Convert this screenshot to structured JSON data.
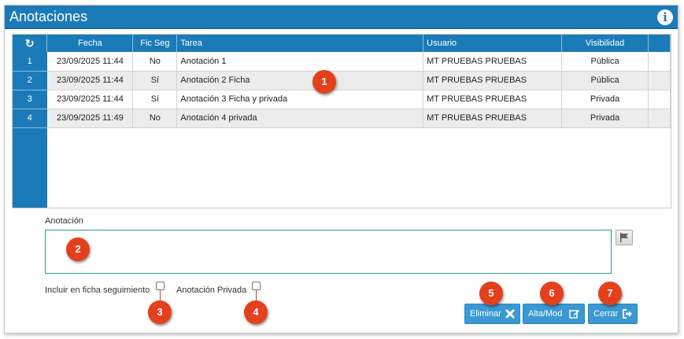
{
  "window": {
    "title": "Anotaciones",
    "info_icon": "info-icon"
  },
  "table": {
    "refresh_icon": "refresh-icon",
    "columns": [
      "Fecha",
      "Fic Seg",
      "Tarea",
      "Usuario",
      "Visibilidad",
      ""
    ],
    "rows": [
      {
        "num": "1",
        "fecha": "23/09/2025 11:44",
        "fic_seg": "No",
        "tarea": "Anotación 1",
        "usuario": "MT PRUEBAS PRUEBAS",
        "visibilidad": "Pública"
      },
      {
        "num": "2",
        "fecha": "23/09/2025 11:44",
        "fic_seg": "Sí",
        "tarea": "Anotación 2 Ficha",
        "usuario": "MT PRUEBAS PRUEBAS",
        "visibilidad": "Pública"
      },
      {
        "num": "3",
        "fecha": "23/09/2025 11:44",
        "fic_seg": "Sí",
        "tarea": "Anotación 3 Ficha y privada",
        "usuario": "MT PRUEBAS PRUEBAS",
        "visibilidad": "Privada"
      },
      {
        "num": "4",
        "fecha": "23/09/2025 11:49",
        "fic_seg": "No",
        "tarea": "Anotación 4 privada",
        "usuario": "MT PRUEBAS PRUEBAS",
        "visibilidad": "Privada"
      }
    ]
  },
  "form": {
    "annotation_label": "Anotación",
    "annotation_value": "",
    "include_followup_label": "Incluir en ficha seguimiento",
    "private_label": "Anotación Privada",
    "flag_icon": "flag-icon"
  },
  "buttons": {
    "delete_label": "Eliminar",
    "save_label": "Alta/Mod",
    "close_label": "Cerrar"
  },
  "callouts": [
    "1",
    "2",
    "3",
    "4",
    "5",
    "6",
    "7"
  ],
  "colors": {
    "accent": "#1b7bb8",
    "button": "#3a99d2",
    "callout": "#e5401c"
  }
}
